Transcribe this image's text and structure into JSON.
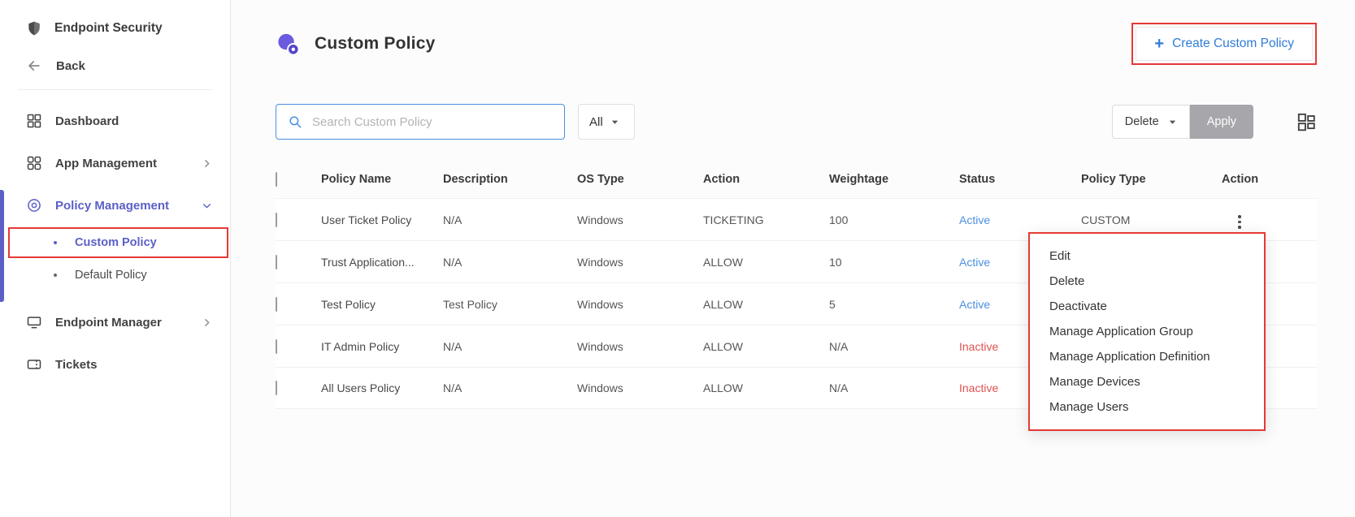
{
  "colors": {
    "accent_purple": "#5b5fc7",
    "active_status_blue": "#4a90e2",
    "inactive_status_red": "#e05252",
    "annotation_red": "#e53935",
    "create_button_blue": "#2e7cd6",
    "apply_button_gray": "#a6a6ab"
  },
  "sidebar": {
    "brand": "Endpoint Security",
    "back": "Back",
    "items": [
      {
        "label": "Dashboard"
      },
      {
        "label": "App Management"
      },
      {
        "label": "Policy Management"
      },
      {
        "label": "Endpoint Manager"
      },
      {
        "label": "Tickets"
      }
    ],
    "policy_submenu": [
      {
        "label": "Custom Policy"
      },
      {
        "label": "Default Policy"
      }
    ]
  },
  "header": {
    "title": "Custom Policy",
    "create_button": "Create Custom Policy"
  },
  "toolbar": {
    "search_placeholder": "Search Custom Policy",
    "filter_value": "All",
    "bulk_action": "Delete",
    "apply": "Apply"
  },
  "table": {
    "columns": [
      "Policy Name",
      "Description",
      "OS Type",
      "Action",
      "Weightage",
      "Status",
      "Policy Type",
      "Action"
    ],
    "rows": [
      {
        "name": "User Ticket Policy",
        "description": "N/A",
        "os": "Windows",
        "action": "TICKETING",
        "weightage": "100",
        "status": "Active",
        "type": "CUSTOM"
      },
      {
        "name": "Trust Application...",
        "description": "N/A",
        "os": "Windows",
        "action": "ALLOW",
        "weightage": "10",
        "status": "Active",
        "type": ""
      },
      {
        "name": "Test Policy",
        "description": "Test Policy",
        "os": "Windows",
        "action": "ALLOW",
        "weightage": "5",
        "status": "Active",
        "type": ""
      },
      {
        "name": "IT Admin Policy",
        "description": "N/A",
        "os": "Windows",
        "action": "ALLOW",
        "weightage": "N/A",
        "status": "Inactive",
        "type": ""
      },
      {
        "name": "All Users Policy",
        "description": "N/A",
        "os": "Windows",
        "action": "ALLOW",
        "weightage": "N/A",
        "status": "Inactive",
        "type": ""
      }
    ]
  },
  "context_menu": {
    "items": [
      "Edit",
      "Delete",
      "Deactivate",
      "Manage Application Group",
      "Manage Application Definition",
      "Manage Devices",
      "Manage Users"
    ]
  }
}
